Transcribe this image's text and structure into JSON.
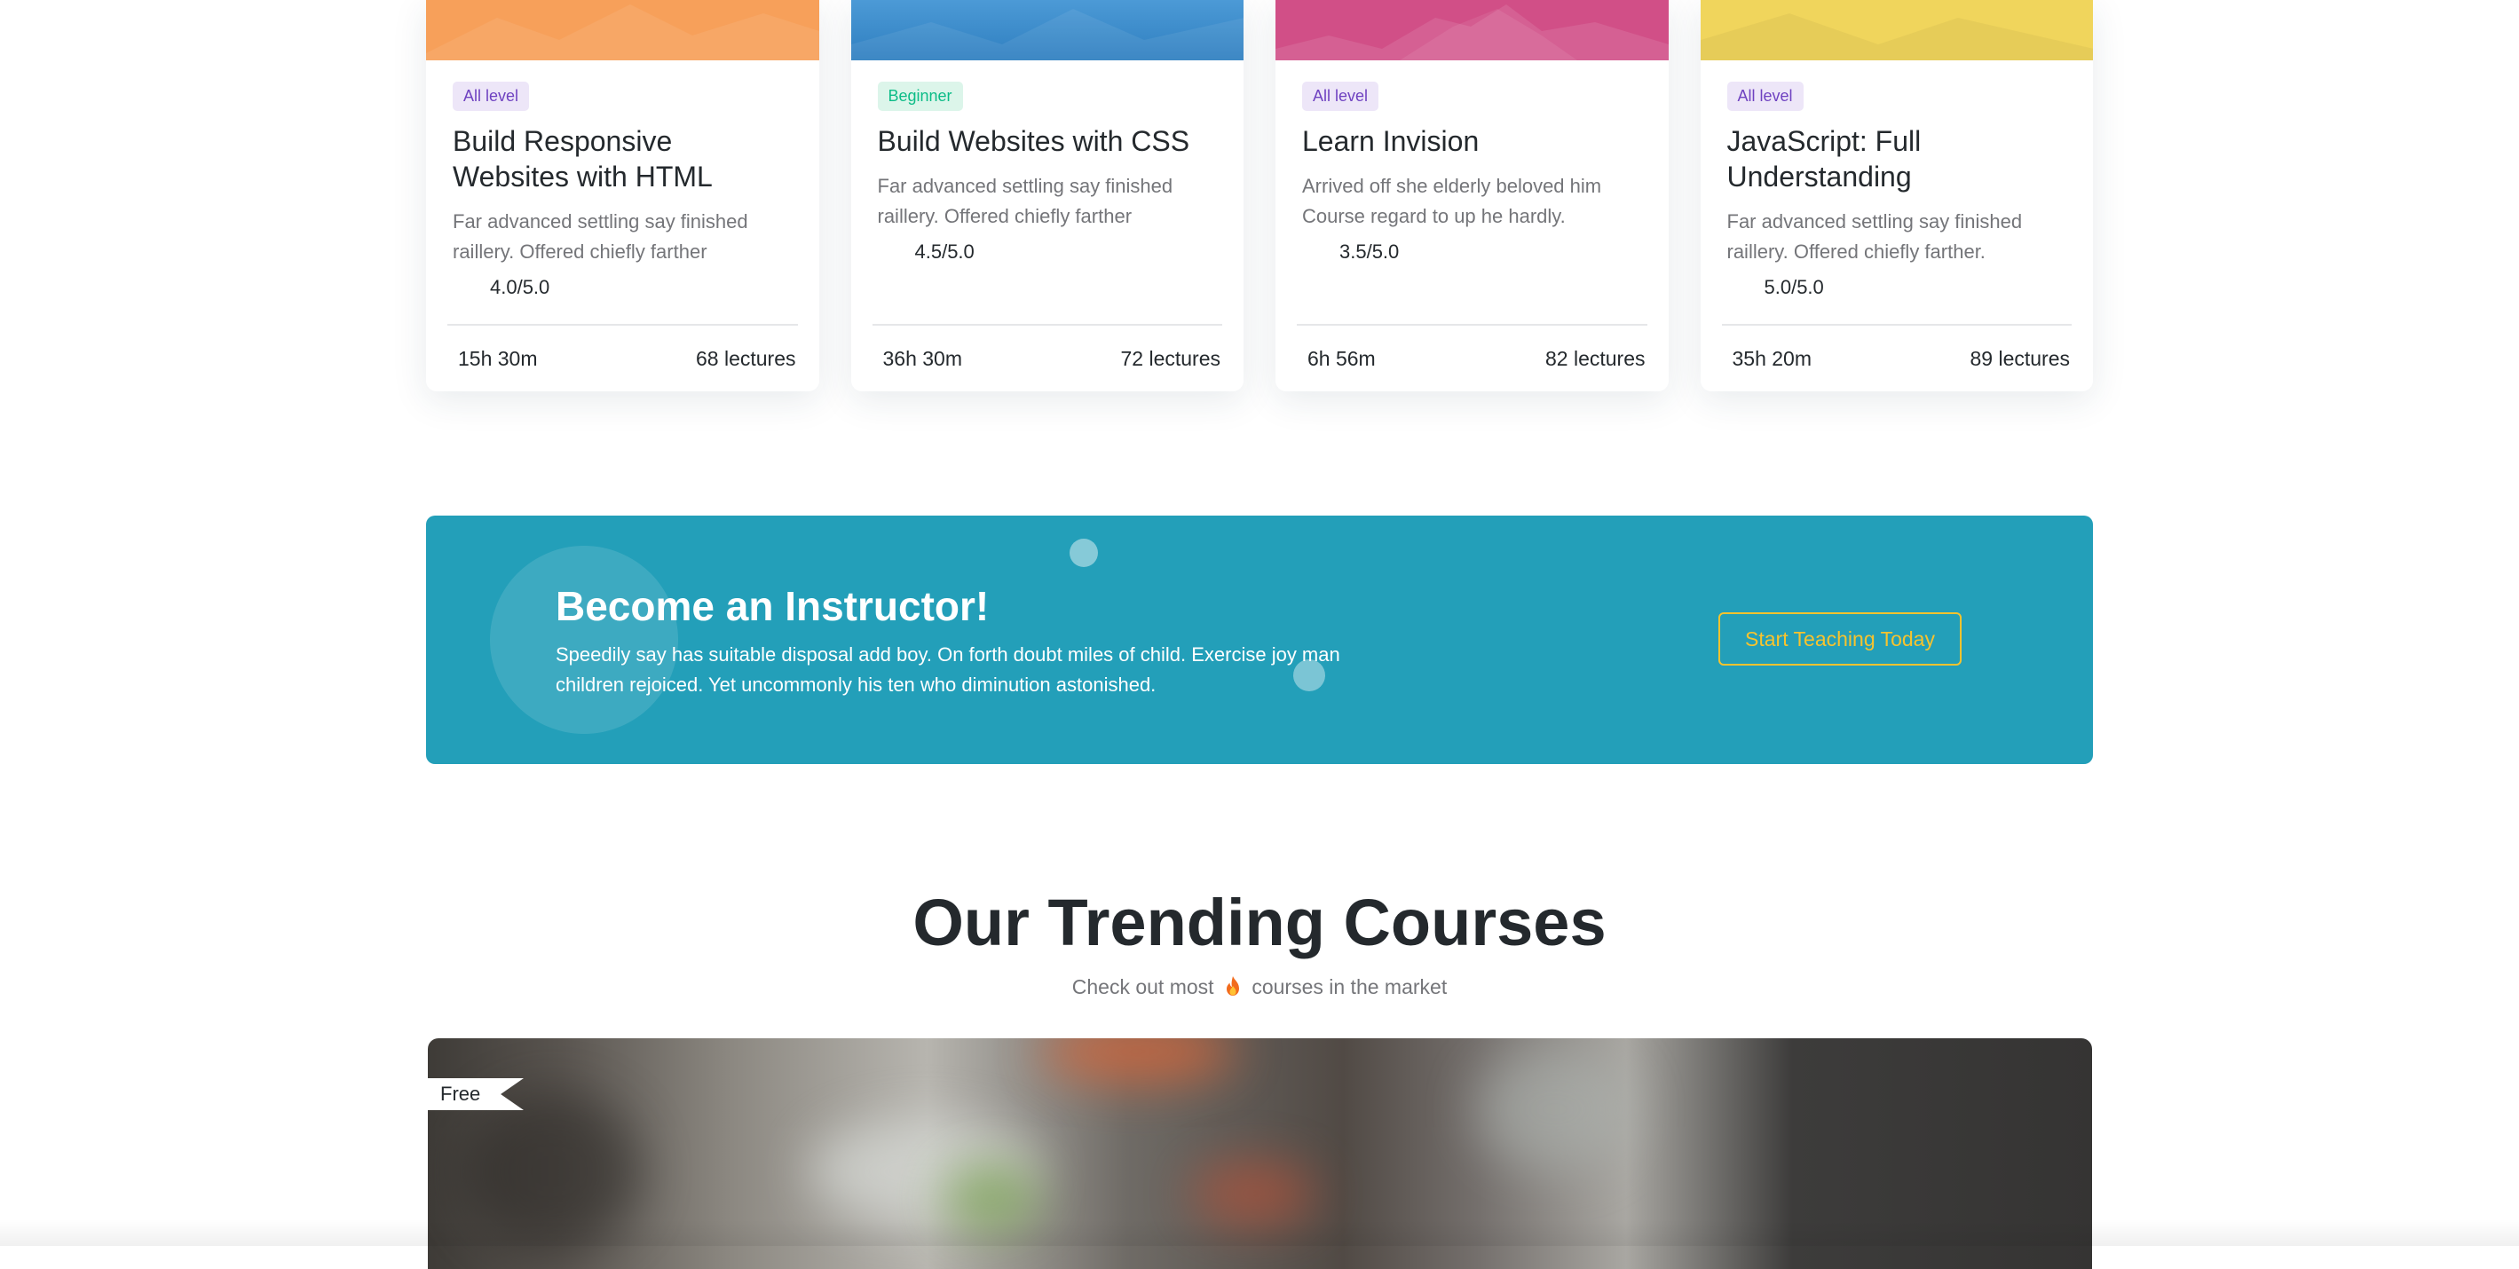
{
  "courses": [
    {
      "level": "All level",
      "title": "Build Responsive Websites with HTML",
      "description": "Far advanced settling say finished raillery. Offered chiefly farther",
      "rating": "4.0/5.0",
      "duration": "15h 30m",
      "lectures": "68 lectures",
      "color": "#f7a05a"
    },
    {
      "level": "Beginner",
      "title": "Build Websites with CSS",
      "description": "Far advanced settling say finished raillery. Offered chiefly farther",
      "rating": "4.5/5.0",
      "duration": "36h 30m",
      "lectures": "72 lectures",
      "color": "#3b8fd0"
    },
    {
      "level": "All level",
      "title": "Learn Invision",
      "description": "Arrived off she elderly beloved him Course regard to up he hardly.",
      "rating": "3.5/5.0",
      "duration": "6h 56m",
      "lectures": "82 lectures",
      "color": "#d14f87"
    },
    {
      "level": "All level",
      "title": "JavaScript: Full Understanding",
      "description": "Far advanced settling say finished raillery. Offered chiefly farther.",
      "rating": "5.0/5.0",
      "duration": "35h 20m",
      "lectures": "89 lectures",
      "color": "#f0d55c"
    }
  ],
  "instructor": {
    "title": "Become an Instructor!",
    "text": "Speedily say has suitable disposal add boy. On forth doubt miles of child. Exercise joy man children rejoiced. Yet uncommonly his ten who diminution astonished.",
    "button": "Start Teaching Today",
    "background": "#239fb9",
    "accent": "#f7c32e"
  },
  "trending": {
    "title": "Our Trending Courses",
    "subtitle_before": "Check out most",
    "subtitle_icon": "fire-icon",
    "subtitle_after": "courses in the market",
    "ribbon": "Free"
  }
}
